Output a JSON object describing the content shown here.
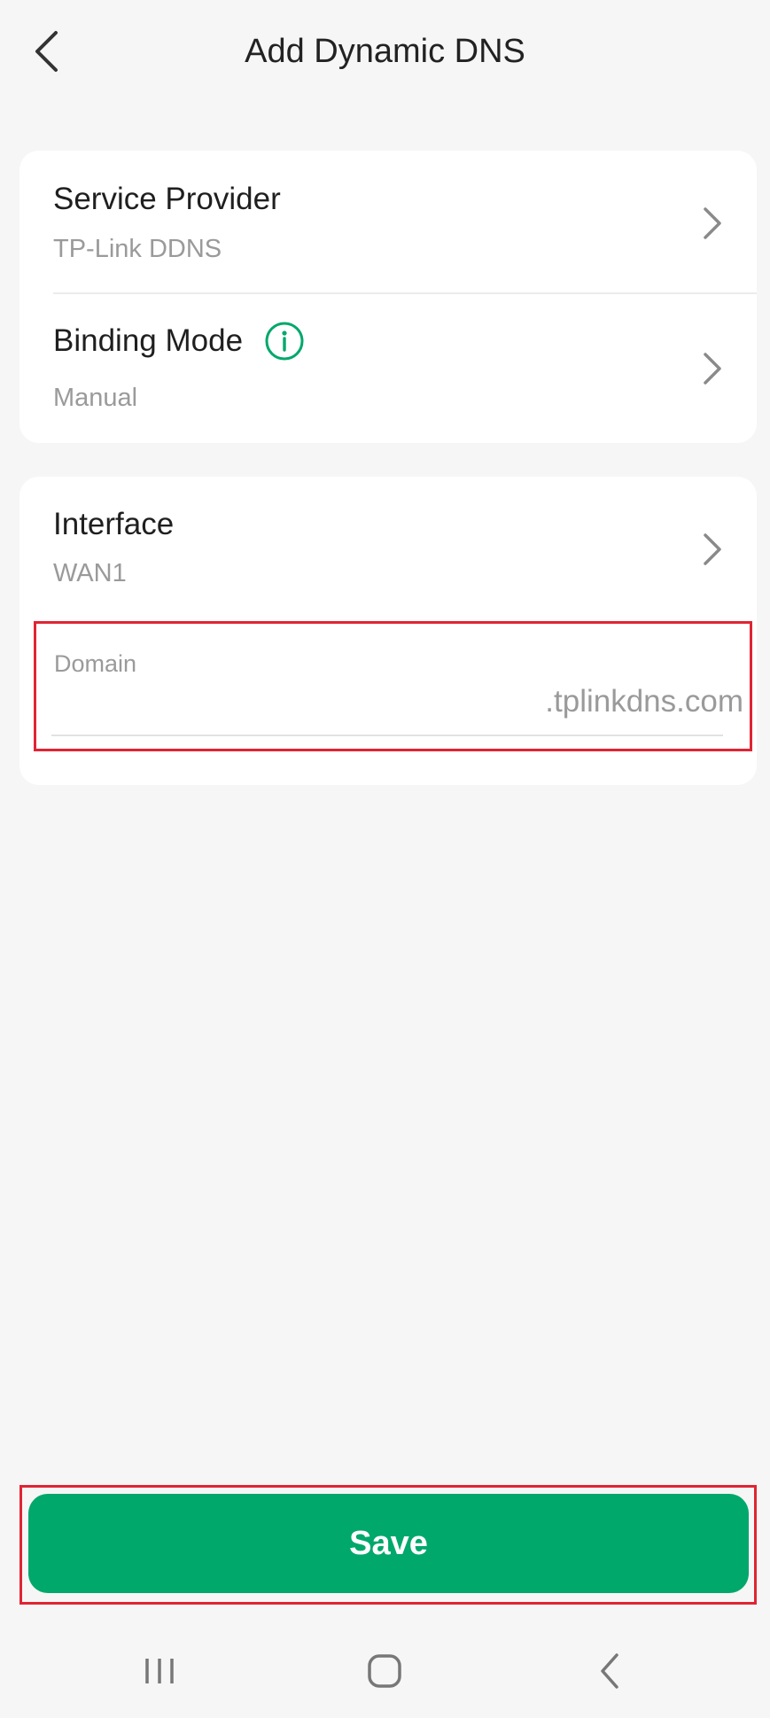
{
  "header": {
    "title": "Add Dynamic DNS"
  },
  "card1": {
    "service_provider": {
      "label": "Service Provider",
      "value": "TP-Link DDNS"
    },
    "binding_mode": {
      "label": "Binding Mode",
      "value": "Manual"
    }
  },
  "card2": {
    "interface": {
      "label": "Interface",
      "value": "WAN1"
    },
    "domain": {
      "label": "Domain",
      "value": "",
      "suffix": ".tplinkdns.com"
    }
  },
  "footer": {
    "save_label": "Save"
  },
  "colors": {
    "accent": "#00a86b",
    "highlight": "#e02433"
  },
  "icons": [
    "back-arrow-icon",
    "info-icon",
    "chevron-right-icon",
    "recent-apps-icon",
    "home-icon",
    "nav-back-icon"
  ]
}
